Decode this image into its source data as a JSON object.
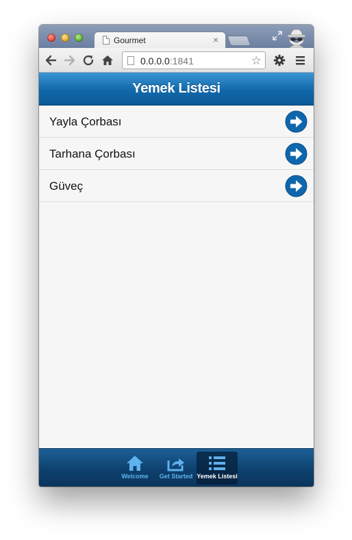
{
  "browser": {
    "tab_title": "Gourmet",
    "tab_close": "×",
    "url_host": "0.0.0.0",
    "url_port": ":1841",
    "icons": [
      "back-icon",
      "forward-icon",
      "reload-icon",
      "home-icon",
      "star-icon",
      "settings-icon",
      "menu-icon",
      "incognito-icon",
      "fullscreen-icon"
    ]
  },
  "app": {
    "title": "Yemek Listesi",
    "accent": "#1168aa",
    "items": [
      {
        "label": "Yayla Çorbası"
      },
      {
        "label": "Tarhana Çorbası"
      },
      {
        "label": "Güveç"
      }
    ]
  },
  "tabbar": {
    "items": [
      {
        "label": "Welcome",
        "icon": "home-icon",
        "active": false
      },
      {
        "label": "Get Started",
        "icon": "share-icon",
        "active": false
      },
      {
        "label": "Yemek Listesi",
        "icon": "list-icon",
        "active": true
      }
    ]
  }
}
